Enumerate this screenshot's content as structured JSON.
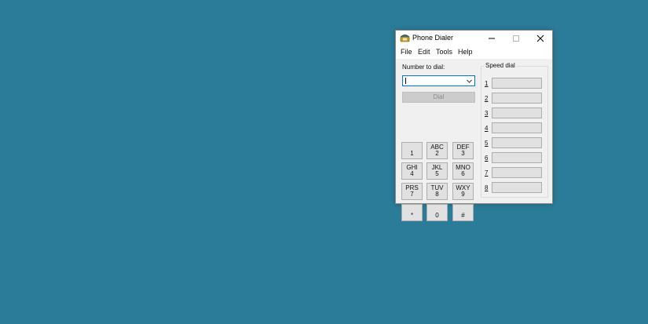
{
  "window": {
    "title": "Phone Dialer"
  },
  "menu": [
    "File",
    "Edit",
    "Tools",
    "Help"
  ],
  "number_to_dial": {
    "label": "Number to dial:",
    "value": ""
  },
  "dial_button": "Dial",
  "keypad": [
    {
      "letters": "",
      "digit": "1"
    },
    {
      "letters": "ABC",
      "digit": "2"
    },
    {
      "letters": "DEF",
      "digit": "3"
    },
    {
      "letters": "GHI",
      "digit": "4"
    },
    {
      "letters": "JKL",
      "digit": "5"
    },
    {
      "letters": "MNO",
      "digit": "6"
    },
    {
      "letters": "PRS",
      "digit": "7"
    },
    {
      "letters": "TUV",
      "digit": "8"
    },
    {
      "letters": "WXY",
      "digit": "9"
    },
    {
      "letters": "",
      "digit": "*"
    },
    {
      "letters": "",
      "digit": "0"
    },
    {
      "letters": "",
      "digit": "#"
    }
  ],
  "speed_dial": {
    "title": "Speed dial",
    "numbers": [
      "1",
      "2",
      "3",
      "4",
      "5",
      "6",
      "7",
      "8"
    ]
  },
  "colors": {
    "desktop": "#2b7c99",
    "window_bg": "#f0f0f0",
    "focus": "#0078d7"
  }
}
